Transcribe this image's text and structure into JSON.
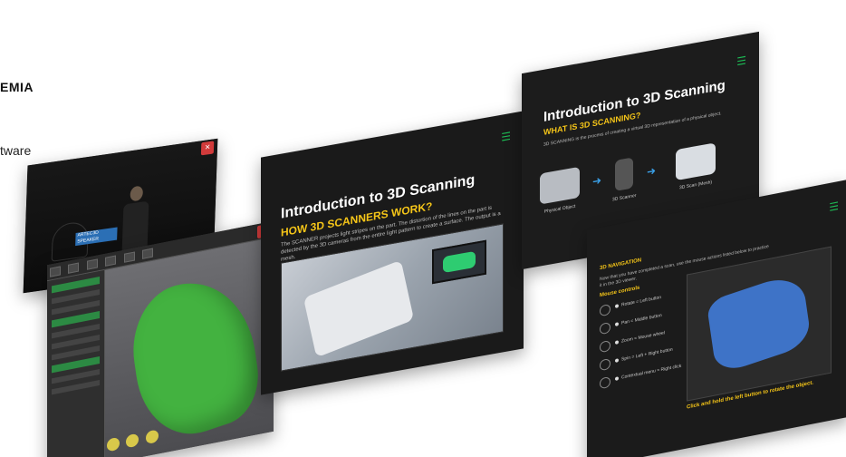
{
  "brand": {
    "title": "EMIA",
    "subtitle": "tware"
  },
  "video": {
    "close": "×",
    "name_tag": "ARTEC3D SPEAKER"
  },
  "software": {
    "close": "×",
    "mesh_color": "#43b240"
  },
  "lesson": {
    "menu_icon": "☰",
    "title": "Introduction to 3D Scanning",
    "subtitle": "HOW 3D SCANNERS WORK?",
    "body": "The SCANNER projects light stripes on the part. The distortion of the lines on the part is detected by the 3D cameras from the entire light pattern to create a surface. The output is a mesh."
  },
  "intro": {
    "menu_icon": "☰",
    "title": "Introduction to 3D Scanning",
    "subtitle": "WHAT IS 3D SCANNING?",
    "body": "3D SCANNING is the process of creating a virtual 3D representation of a physical object.",
    "flow": [
      {
        "caption": "Physical Object"
      },
      {
        "caption": "3D Scanner"
      },
      {
        "caption": "3D Scan (Mesh)"
      }
    ],
    "arrow": "➜"
  },
  "nav": {
    "menu_icon": "☰",
    "header": "3D NAVIGATION",
    "intro": "Now that you have completed a scan, use the mouse actions listed below to practice it in the 3D viewer.",
    "section": "Mouse controls",
    "items": [
      {
        "label": "Rotate = Left button"
      },
      {
        "label": "Pan = Middle button"
      },
      {
        "label": "Zoom = Mouse wheel"
      },
      {
        "label": "Spin = Left + Right button"
      },
      {
        "label": "Contextual menu = Right click"
      }
    ],
    "hint": "Click and hold the left button to rotate the object."
  }
}
